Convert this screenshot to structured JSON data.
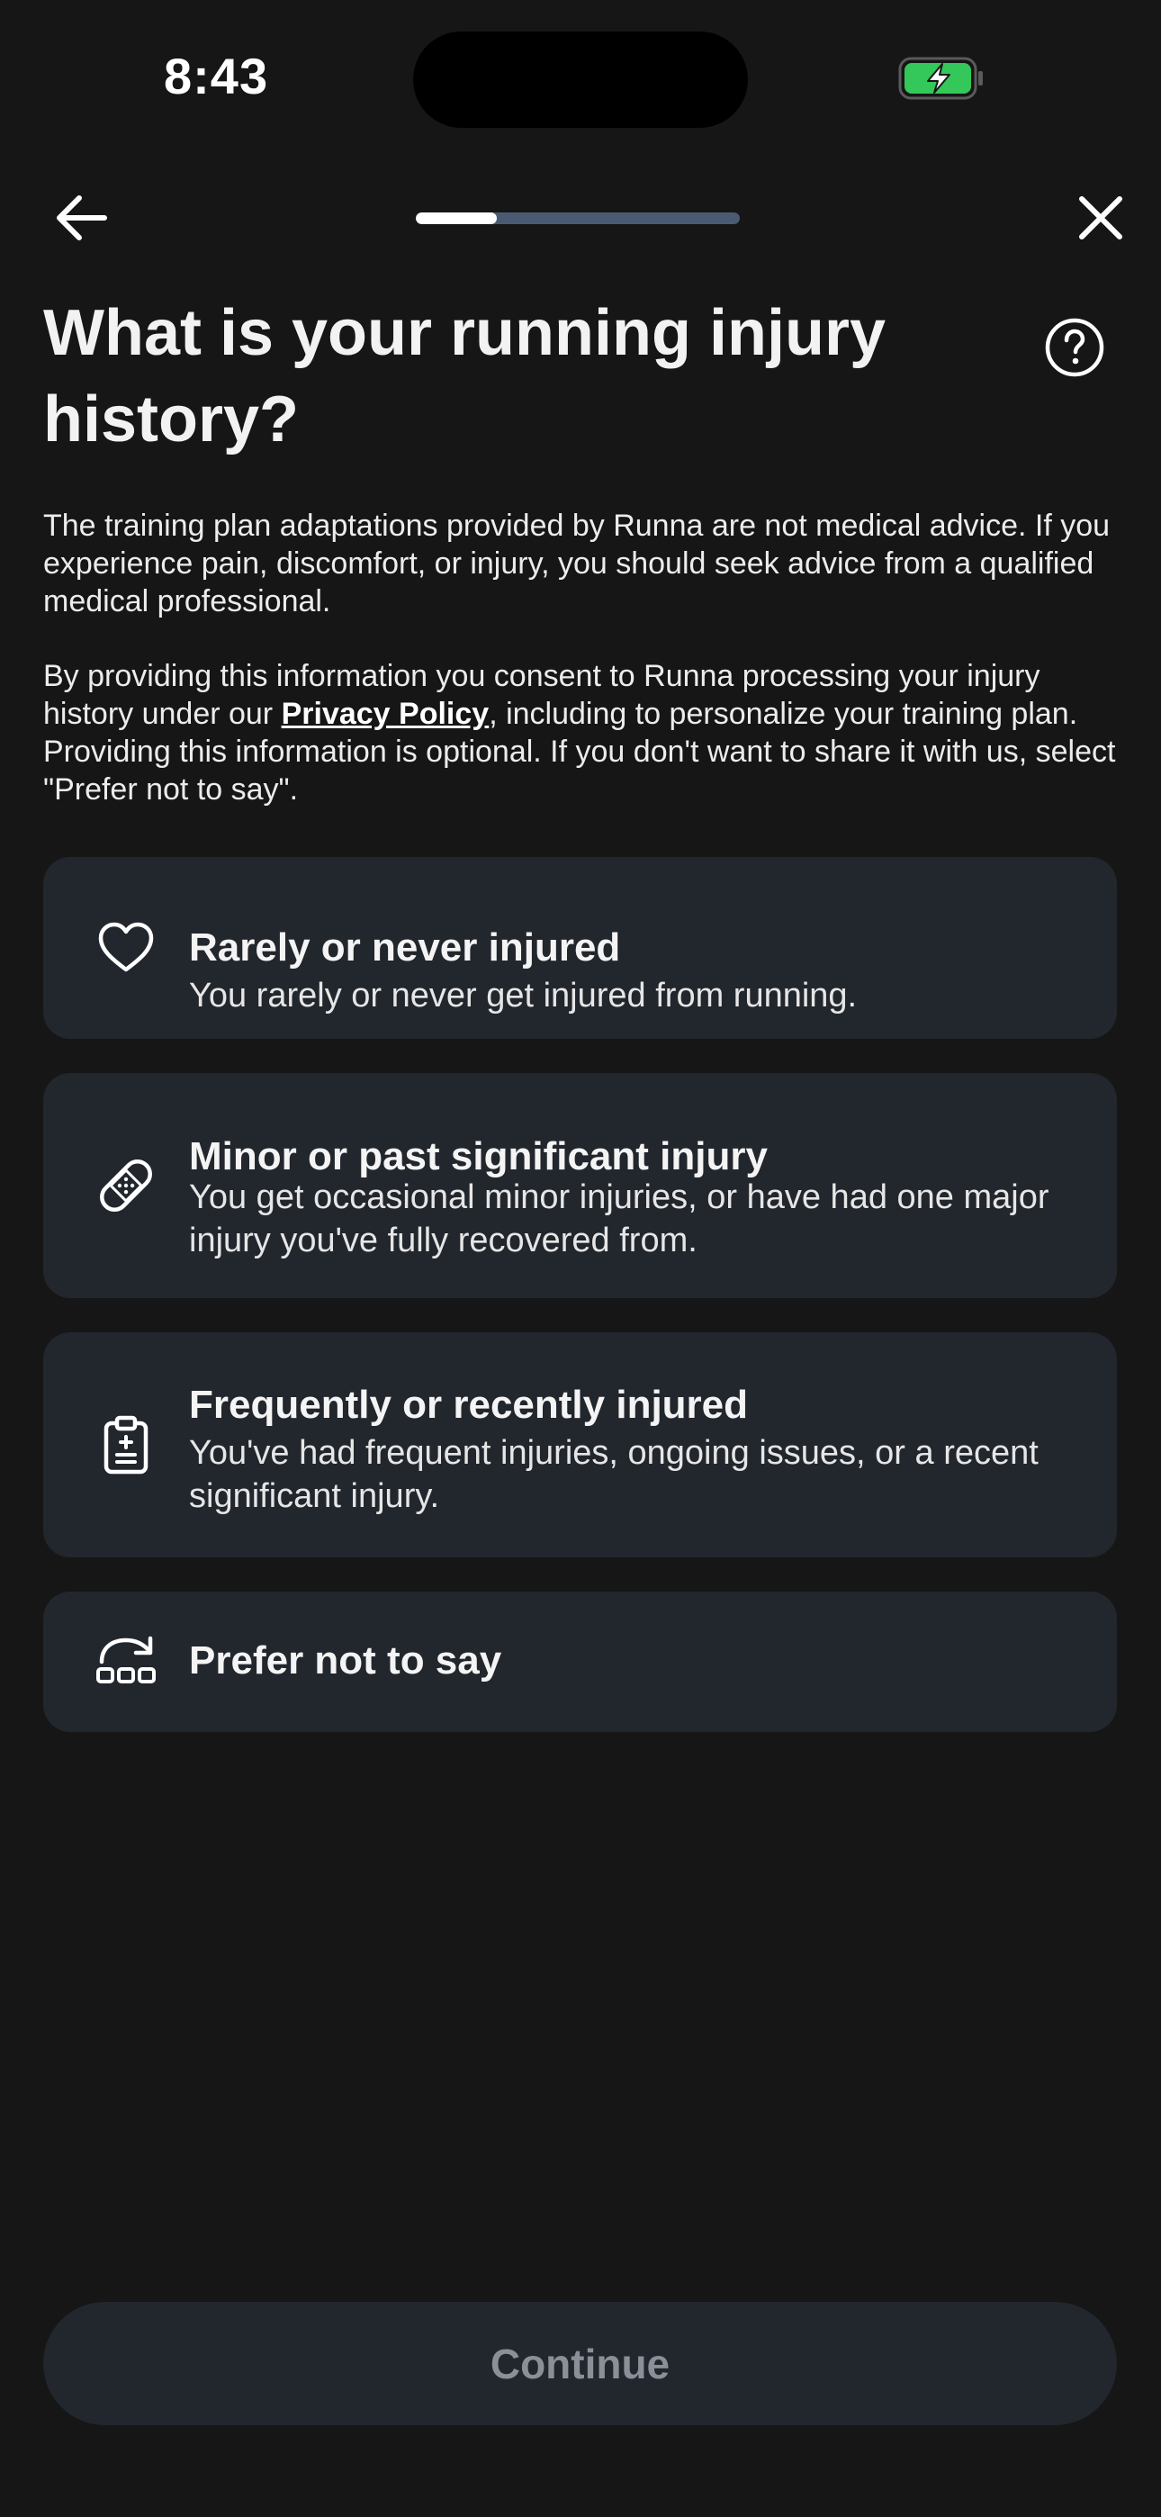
{
  "status_bar": {
    "time": "8:43"
  },
  "progress": {
    "fraction": 0.25
  },
  "header": {
    "title": "What is your running injury history?"
  },
  "info": {
    "disclaimer": "The training plan adaptations provided by Runna are not medical advice. If you experience pain, discomfort, or injury, you should seek advice from a qualified medical professional.",
    "consent_prefix": "By providing this information you consent to Runna processing your injury history under our ",
    "privacy_link": "Privacy Policy",
    "consent_suffix": ", including to personalize your training plan. Providing this information is optional. If you don't want to share it with us, select \"Prefer not to say\"."
  },
  "options": [
    {
      "icon": "heart-icon",
      "title": "Rarely or never injured",
      "description": "You rarely or never get injured from running."
    },
    {
      "icon": "bandage-icon",
      "title": "Minor or past significant injury",
      "description": "You get occasional minor injuries, or have had one major injury you've fully recovered from."
    },
    {
      "icon": "clipboard-medical-icon",
      "title": "Frequently or recently injured",
      "description": "You've had frequent injuries, ongoing issues, or a recent significant injury."
    },
    {
      "icon": "skip-icon",
      "title": "Prefer not to say",
      "description": ""
    }
  ],
  "footer": {
    "continue_label": "Continue"
  },
  "colors": {
    "background": "#161616",
    "card": "#22262d",
    "progress_track": "#4a5a72",
    "battery_green": "#34c759",
    "disabled_text": "#8a8f98"
  }
}
